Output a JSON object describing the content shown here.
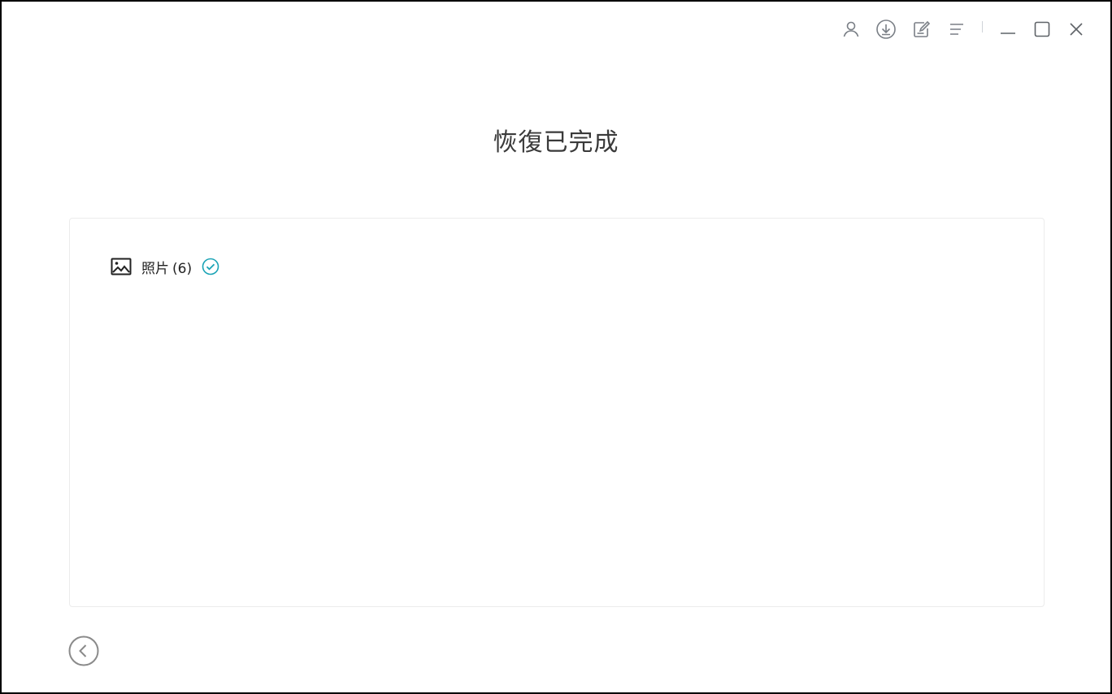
{
  "titlebar": {
    "icons": [
      "user-icon",
      "download-icon",
      "feedback-icon",
      "menu-icon",
      "minimize-icon",
      "maximize-icon",
      "close-icon"
    ]
  },
  "page": {
    "title": "恢復已完成"
  },
  "results": {
    "items": [
      {
        "label": "照片",
        "count": "(6)",
        "icon": "photo-icon",
        "status": "completed"
      }
    ]
  },
  "footer": {
    "back_icon": "back-icon"
  },
  "colors": {
    "accent": "#1aa3b5",
    "icon_gray": "#7a7f86",
    "text": "#222222"
  }
}
